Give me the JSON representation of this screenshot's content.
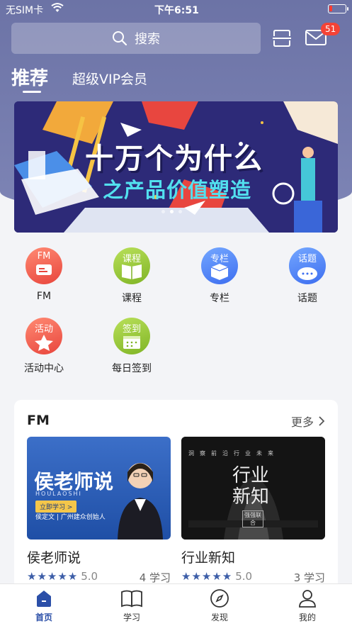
{
  "status_bar": {
    "carrier": "无SIM卡",
    "time": "下午6:51"
  },
  "search": {
    "placeholder": "搜索"
  },
  "header": {
    "mail_badge": "51"
  },
  "tabs": [
    {
      "label": "推荐",
      "active": true
    },
    {
      "label": "超级VIP会员",
      "active": false
    }
  ],
  "banner": {
    "title": "十万个为什么",
    "subtitle": "之产品价值塑造",
    "dot_count": 3,
    "active_dot": 1
  },
  "categories": [
    {
      "label": "FM",
      "icon_text": "FM",
      "icon": "radio-icon",
      "color": "#e8453c"
    },
    {
      "label": "课程",
      "icon_text": "课程",
      "icon": "book-icon",
      "color": "#7fb425"
    },
    {
      "label": "专栏",
      "icon_text": "专栏",
      "icon": "box-icon",
      "color": "#3d6ef0"
    },
    {
      "label": "话题",
      "icon_text": "话题",
      "icon": "chat-icon",
      "color": "#3d6ef0"
    },
    {
      "label": "活动中心",
      "icon_text": "活动",
      "icon": "star-icon",
      "color": "#e8453c"
    },
    {
      "label": "每日签到",
      "icon_text": "签到",
      "icon": "calendar-icon",
      "color": "#7fb425"
    }
  ],
  "fm_section": {
    "title": "FM",
    "more_label": "更多",
    "items": [
      {
        "title": "侯老师说",
        "rating": "5.0",
        "learners": "4 学习",
        "cover": {
          "headline": "侯老师说",
          "pinyin": "HOULAOSHI",
          "button": "立即学习 >",
          "author": "侯定文 | 广州建众创始人"
        }
      },
      {
        "title": "行业新知",
        "rating": "5.0",
        "learners": "3 学习",
        "cover": {
          "top_text": "洞察前沿行业未来",
          "headline": "行业新知",
          "seal": "强强联合"
        }
      }
    ]
  },
  "tab_bar": [
    {
      "label": "首页",
      "icon": "home-icon",
      "active": true
    },
    {
      "label": "学习",
      "icon": "book-open-icon",
      "active": false
    },
    {
      "label": "发现",
      "icon": "compass-icon",
      "active": false
    },
    {
      "label": "我的",
      "icon": "user-icon",
      "active": false
    }
  ],
  "colors": {
    "header": "#6c73a6",
    "accent": "#2b4fa8",
    "badge": "#f44336"
  }
}
